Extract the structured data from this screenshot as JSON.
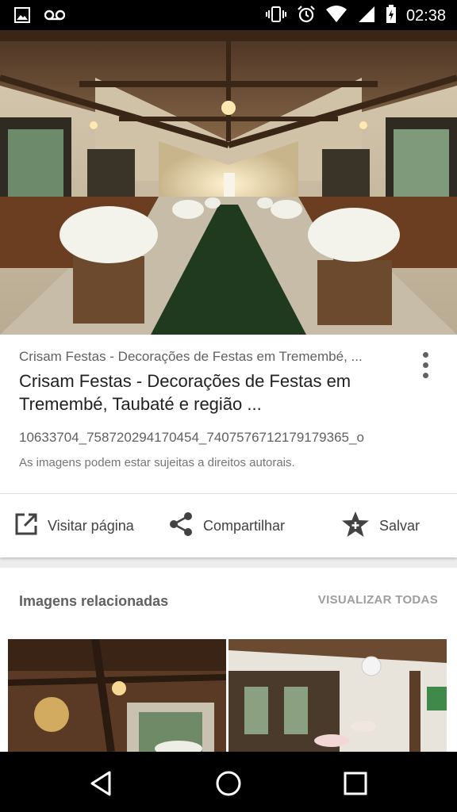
{
  "status_bar": {
    "time": "02:38",
    "icons": [
      "image-notification-icon",
      "voicemail-icon",
      "vibrate-icon",
      "alarm-icon",
      "wifi-icon",
      "signal-icon",
      "battery-charging-icon"
    ]
  },
  "result": {
    "source": "Crisam Festas - Decorações de Festas em Tremembé, ...",
    "title": "Crisam Festas - Decorações de Festas em Tremembé, Taubaté e região ...",
    "filename": "10633704_758720294170454_7407576712179179365_o",
    "rights_notice": "As imagens podem estar sujeitas a direitos autorais."
  },
  "actions": {
    "visit_label": "Visitar página",
    "share_label": "Compartilhar",
    "save_label": "Salvar"
  },
  "related": {
    "title": "Imagens relacionadas",
    "view_all_label": "VISUALIZAR TODAS"
  },
  "colors": {
    "text_primary": "#212121",
    "text_secondary": "#616161",
    "status_bar": "#000000",
    "nav_bar": "#000000"
  }
}
